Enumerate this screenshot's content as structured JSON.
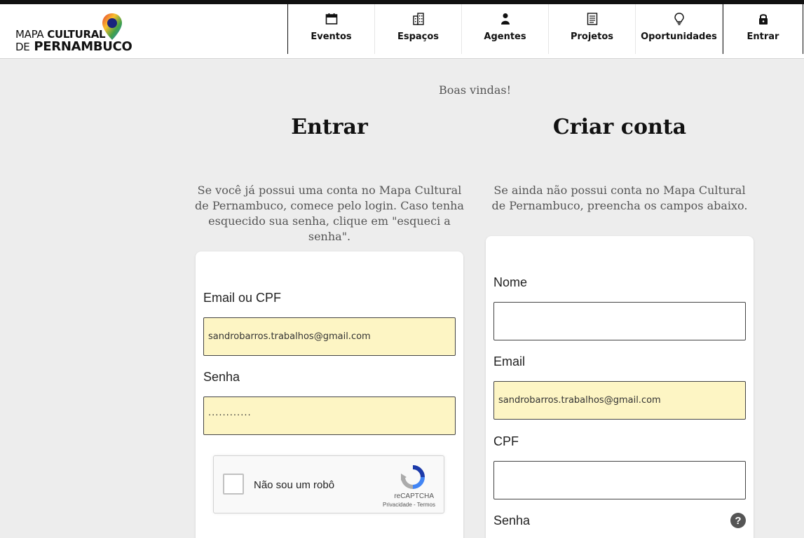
{
  "header": {
    "logo": {
      "line1_thin": "MAPA",
      "line1_bold": "CULTURAL",
      "line2_thin": "DE",
      "line2_bold": "PERNAMBUCO"
    },
    "nav": [
      {
        "label": "Eventos",
        "icon": "calendar-icon"
      },
      {
        "label": "Espaços",
        "icon": "building-icon"
      },
      {
        "label": "Agentes",
        "icon": "person-icon"
      },
      {
        "label": "Projetos",
        "icon": "document-icon"
      },
      {
        "label": "Oportunidades",
        "icon": "lightbulb-icon"
      },
      {
        "label": "Entrar",
        "icon": "lock-icon"
      }
    ]
  },
  "main": {
    "welcome": "Boas vindas!",
    "login": {
      "title": "Entrar",
      "description": "Se você já possui uma conta no Mapa Cultural de Pernambuco, comece pelo login. Caso tenha esquecido sua senha, clique em \"esqueci a senha\".",
      "email_label": "Email ou CPF",
      "email_value": "sandrobarros.trabalhos@gmail.com",
      "password_label": "Senha",
      "password_value": "············",
      "captcha": {
        "label": "Não sou um robô",
        "brand": "reCAPTCHA",
        "links": "Privacidade - Termos"
      }
    },
    "signup": {
      "title": "Criar conta",
      "description": "Se ainda não possui conta no Mapa Cultural de Pernambuco, preencha os campos abaixo.",
      "name_label": "Nome",
      "name_value": "",
      "email_label": "Email",
      "email_value": "sandrobarros.trabalhos@gmail.com",
      "cpf_label": "CPF",
      "cpf_value": "",
      "password_label": "Senha",
      "help_symbol": "?"
    }
  }
}
